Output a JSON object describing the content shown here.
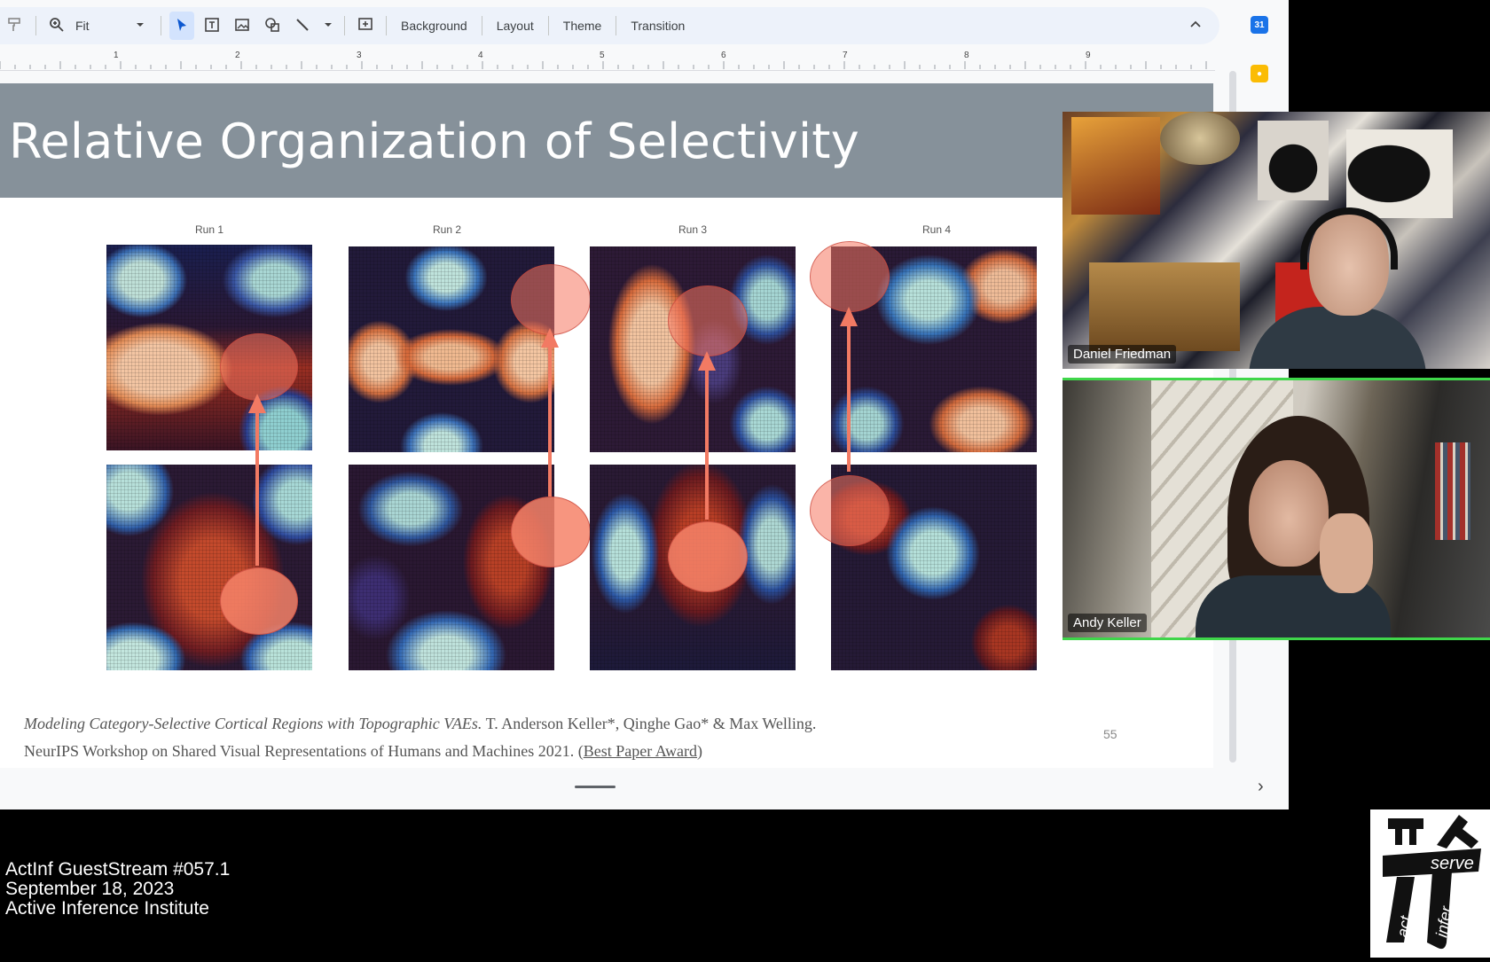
{
  "toolbar": {
    "zoom_value": "Fit",
    "buttons": [
      "Background",
      "Layout",
      "Theme",
      "Transition"
    ]
  },
  "ruler": {
    "marks": [
      "1",
      "2",
      "3",
      "4",
      "5",
      "6",
      "7",
      "8",
      "9"
    ]
  },
  "slide": {
    "title": "Relative Organization of Selectivity",
    "runs": [
      "Run 1",
      "Run 2",
      "Run 3",
      "Run 4"
    ],
    "caption_line1_title": "Modeling Category-Selective Cortical Regions with Topographic VAEs.",
    "caption_line1_authors": " T. Anderson Keller*, Qinghe Gao* & Max Welling.",
    "caption_line2_text": "NeurIPS Workshop on Shared Visual Representations of Humans and Machines 2021. (",
    "caption_line2_link": "Best Paper Award",
    "caption_line2_end": ")",
    "page_number": "55"
  },
  "participants": [
    {
      "name": "Daniel Friedman"
    },
    {
      "name": "Andy Keller"
    }
  ],
  "stream": {
    "line1": "ActInf GuestStream #057.1",
    "line2": "September 18, 2023",
    "line3": "Active Inference Institute"
  },
  "logo": {
    "serve": "serve",
    "act": "act",
    "infer": "infer"
  },
  "colors": {
    "title_bar": "#86919a",
    "highlight": "#f27a63",
    "active_speaker": "#3fd64a",
    "toolbar_bg": "#edf2fa"
  }
}
